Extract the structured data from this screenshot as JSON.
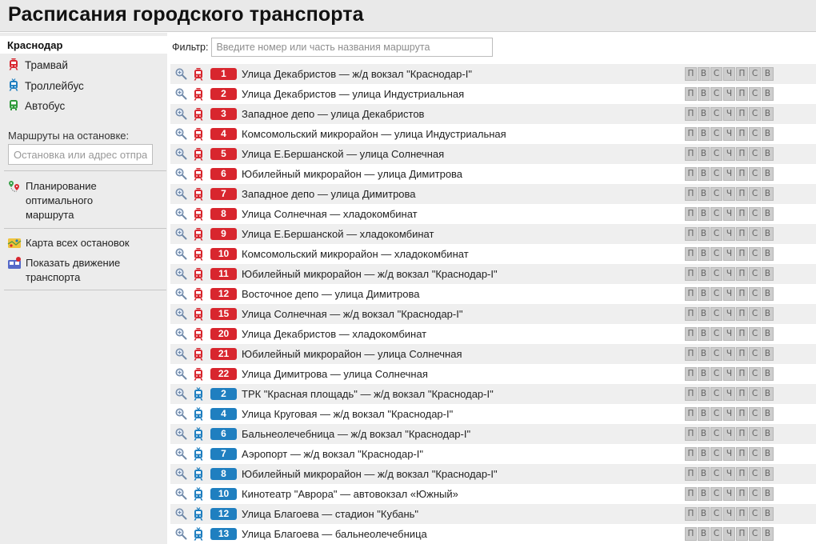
{
  "page": {
    "title": "Расписания городского транспорта"
  },
  "colors": {
    "tram": "#d8262e",
    "trolleybus": "#1f7fc0",
    "bus": "#2e9a3a"
  },
  "sidebar": {
    "city": "Краснодар",
    "types": [
      {
        "label": "Трамвай",
        "icon": "tram-icon",
        "kind": "tram"
      },
      {
        "label": "Троллейбус",
        "icon": "trolleybus-icon",
        "kind": "trolleybus"
      },
      {
        "label": "Автобус",
        "icon": "bus-icon",
        "kind": "bus"
      }
    ],
    "stop_label": "Маршруты на остановке:",
    "stop_placeholder": "Остановка или адрес отправления",
    "links": [
      {
        "label": "Планирование оптимального маршрута",
        "icon": "route-planner-icon"
      },
      {
        "label": "Карта всех остановок",
        "icon": "stops-map-icon"
      },
      {
        "label": "Показать движение транспорта",
        "icon": "live-transport-icon"
      }
    ]
  },
  "filter": {
    "label": "Фильтр:",
    "placeholder": "Введите номер или часть названия маршрута"
  },
  "days": [
    "П",
    "В",
    "С",
    "Ч",
    "П",
    "С",
    "В"
  ],
  "routes": [
    {
      "type": "tram",
      "number": "1",
      "name": "Улица Декабристов — ж/д вокзал \"Краснодар-I\""
    },
    {
      "type": "tram",
      "number": "2",
      "name": "Улица Декабристов — улица Индустриальная"
    },
    {
      "type": "tram",
      "number": "3",
      "name": "Западное депо — улица Декабристов"
    },
    {
      "type": "tram",
      "number": "4",
      "name": "Комсомольский микрорайон — улица Индустриальная"
    },
    {
      "type": "tram",
      "number": "5",
      "name": "Улица Е.Бершанской — улица Солнечная"
    },
    {
      "type": "tram",
      "number": "6",
      "name": "Юбилейный микрорайон — улица Димитрова"
    },
    {
      "type": "tram",
      "number": "7",
      "name": "Западное депо — улица Димитрова"
    },
    {
      "type": "tram",
      "number": "8",
      "name": "Улица Солнечная — хладокомбинат"
    },
    {
      "type": "tram",
      "number": "9",
      "name": "Улица Е.Бершанской — хладокомбинат"
    },
    {
      "type": "tram",
      "number": "10",
      "name": "Комсомольский микрорайон — хладокомбинат"
    },
    {
      "type": "tram",
      "number": "11",
      "name": "Юбилейный микрорайон — ж/д вокзал \"Краснодар-I\""
    },
    {
      "type": "tram",
      "number": "12",
      "name": "Восточное депо — улица Димитрова"
    },
    {
      "type": "tram",
      "number": "15",
      "name": "Улица Солнечная — ж/д вокзал \"Краснодар-I\""
    },
    {
      "type": "tram",
      "number": "20",
      "name": "Улица Декабристов — хладокомбинат"
    },
    {
      "type": "tram",
      "number": "21",
      "name": "Юбилейный микрорайон — улица Солнечная"
    },
    {
      "type": "tram",
      "number": "22",
      "name": "Улица Димитрова — улица Солнечная"
    },
    {
      "type": "trolleybus",
      "number": "2",
      "name": "ТРК \"Красная площадь\" — ж/д вокзал \"Краснодар-I\""
    },
    {
      "type": "trolleybus",
      "number": "4",
      "name": "Улица Круговая — ж/д вокзал \"Краснодар-I\""
    },
    {
      "type": "trolleybus",
      "number": "6",
      "name": "Бальнеолечебница — ж/д вокзал \"Краснодар-I\""
    },
    {
      "type": "trolleybus",
      "number": "7",
      "name": "Аэропорт — ж/д вокзал \"Краснодар-I\""
    },
    {
      "type": "trolleybus",
      "number": "8",
      "name": "Юбилейный микрорайон — ж/д вокзал \"Краснодар-I\""
    },
    {
      "type": "trolleybus",
      "number": "10",
      "name": "Кинотеатр \"Аврора\" — автовокзал «Южный»"
    },
    {
      "type": "trolleybus",
      "number": "12",
      "name": "Улица Благоева — стадион \"Кубань\""
    },
    {
      "type": "trolleybus",
      "number": "13",
      "name": "Улица Благоева — бальнеолечебница"
    }
  ]
}
